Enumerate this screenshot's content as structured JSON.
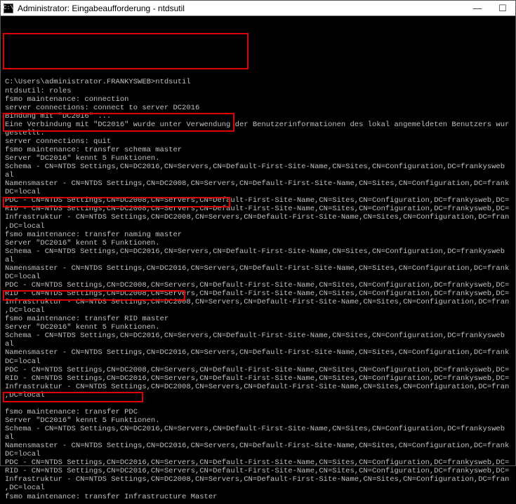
{
  "titlebar": {
    "icon_label": "C:\\",
    "title": "Administrator: Eingabeaufforderung - ntdsutil",
    "minimize": "—",
    "maximize": "☐"
  },
  "lines": [
    "",
    "C:\\Users\\administrator.FRANKYSWEB>ntdsutil",
    "ntdsutil: roles",
    "fsmo maintenance: connection",
    "server connections: connect to server DC2016",
    "Bindung mit \"DC2016\" ...",
    "Eine Verbindung mit \"DC2016\" wurde unter Verwendung der Benutzerinformationen des lokal angemeldeten Benutzers wur",
    "gestellt.",
    "server connections: quit",
    "fsmo maintenance: transfer schema master",
    "Server \"DC2016\" kennt 5 Funktionen.",
    "Schema - CN=NTDS Settings,CN=DC2016,CN=Servers,CN=Default-First-Site-Name,CN=Sites,CN=Configuration,DC=frankysweb",
    "al",
    "Namensmaster - CN=NTDS Settings,CN=DC2008,CN=Servers,CN=Default-First-Site-Name,CN=Sites,CN=Configuration,DC=frank",
    "DC=local",
    "PDC - CN=NTDS Settings,CN=DC2008,CN=Servers,CN=Default-First-Site-Name,CN=Sites,CN=Configuration,DC=frankysweb,DC=",
    "RID - CN=NTDS Settings,CN=DC2008,CN=Servers,CN=Default-First-Site-Name,CN=Sites,CN=Configuration,DC=frankysweb,DC=",
    "Infrastruktur - CN=NTDS Settings,CN=DC2008,CN=Servers,CN=Default-First-Site-Name,CN=Sites,CN=Configuration,DC=fran",
    ",DC=local",
    "fsmo maintenance: transfer naming master",
    "Server \"DC2016\" kennt 5 Funktionen.",
    "Schema - CN=NTDS Settings,CN=DC2016,CN=Servers,CN=Default-First-Site-Name,CN=Sites,CN=Configuration,DC=frankysweb",
    "al",
    "Namensmaster - CN=NTDS Settings,CN=DC2016,CN=Servers,CN=Default-First-Site-Name,CN=Sites,CN=Configuration,DC=frank",
    "DC=local",
    "PDC - CN=NTDS Settings,CN=DC2008,CN=Servers,CN=Default-First-Site-Name,CN=Sites,CN=Configuration,DC=frankysweb,DC=",
    "RID - CN=NTDS Settings,CN=DC2008,CN=Servers,CN=Default-First-Site-Name,CN=Sites,CN=Configuration,DC=frankysweb,DC=",
    "Infrastruktur - CN=NTDS Settings,CN=DC2008,CN=Servers,CN=Default-First-Site-Name,CN=Sites,CN=Configuration,DC=fran",
    ",DC=local",
    "fsmo maintenance: transfer RID master",
    "Server \"DC2016\" kennt 5 Funktionen.",
    "Schema - CN=NTDS Settings,CN=DC2016,CN=Servers,CN=Default-First-Site-Name,CN=Sites,CN=Configuration,DC=frankysweb",
    "al",
    "Namensmaster - CN=NTDS Settings,CN=DC2016,CN=Servers,CN=Default-First-Site-Name,CN=Sites,CN=Configuration,DC=frank",
    "DC=local",
    "PDC - CN=NTDS Settings,CN=DC2008,CN=Servers,CN=Default-First-Site-Name,CN=Sites,CN=Configuration,DC=frankysweb,DC=",
    "RID - CN=NTDS Settings,CN=DC2016,CN=Servers,CN=Default-First-Site-Name,CN=Sites,CN=Configuration,DC=frankysweb,DC=",
    "Infrastruktur - CN=NTDS Settings,CN=DC2008,CN=Servers,CN=Default-First-Site-Name,CN=Sites,CN=Configuration,DC=fran",
    ",DC=local",
    "",
    "fsmo maintenance: transfer PDC",
    "Server \"DC2016\" kennt 5 Funktionen.",
    "Schema - CN=NTDS Settings,CN=DC2016,CN=Servers,CN=Default-First-Site-Name,CN=Sites,CN=Configuration,DC=frankysweb",
    "al",
    "Namensmaster - CN=NTDS Settings,CN=DC2016,CN=Servers,CN=Default-First-Site-Name,CN=Sites,CN=Configuration,DC=frank",
    "DC=local",
    "PDC - CN=NTDS Settings,CN=DC2016,CN=Servers,CN=Default-First-Site-Name,CN=Sites,CN=Configuration,DC=frankysweb,DC=",
    "RID - CN=NTDS Settings,CN=DC2016,CN=Servers,CN=Default-First-Site-Name,CN=Sites,CN=Configuration,DC=frankysweb,DC=",
    "Infrastruktur - CN=NTDS Settings,CN=DC2008,CN=Servers,CN=Default-First-Site-Name,CN=Sites,CN=Configuration,DC=fran",
    ",DC=local",
    "fsmo maintenance: transfer Infrastructure Master"
  ]
}
